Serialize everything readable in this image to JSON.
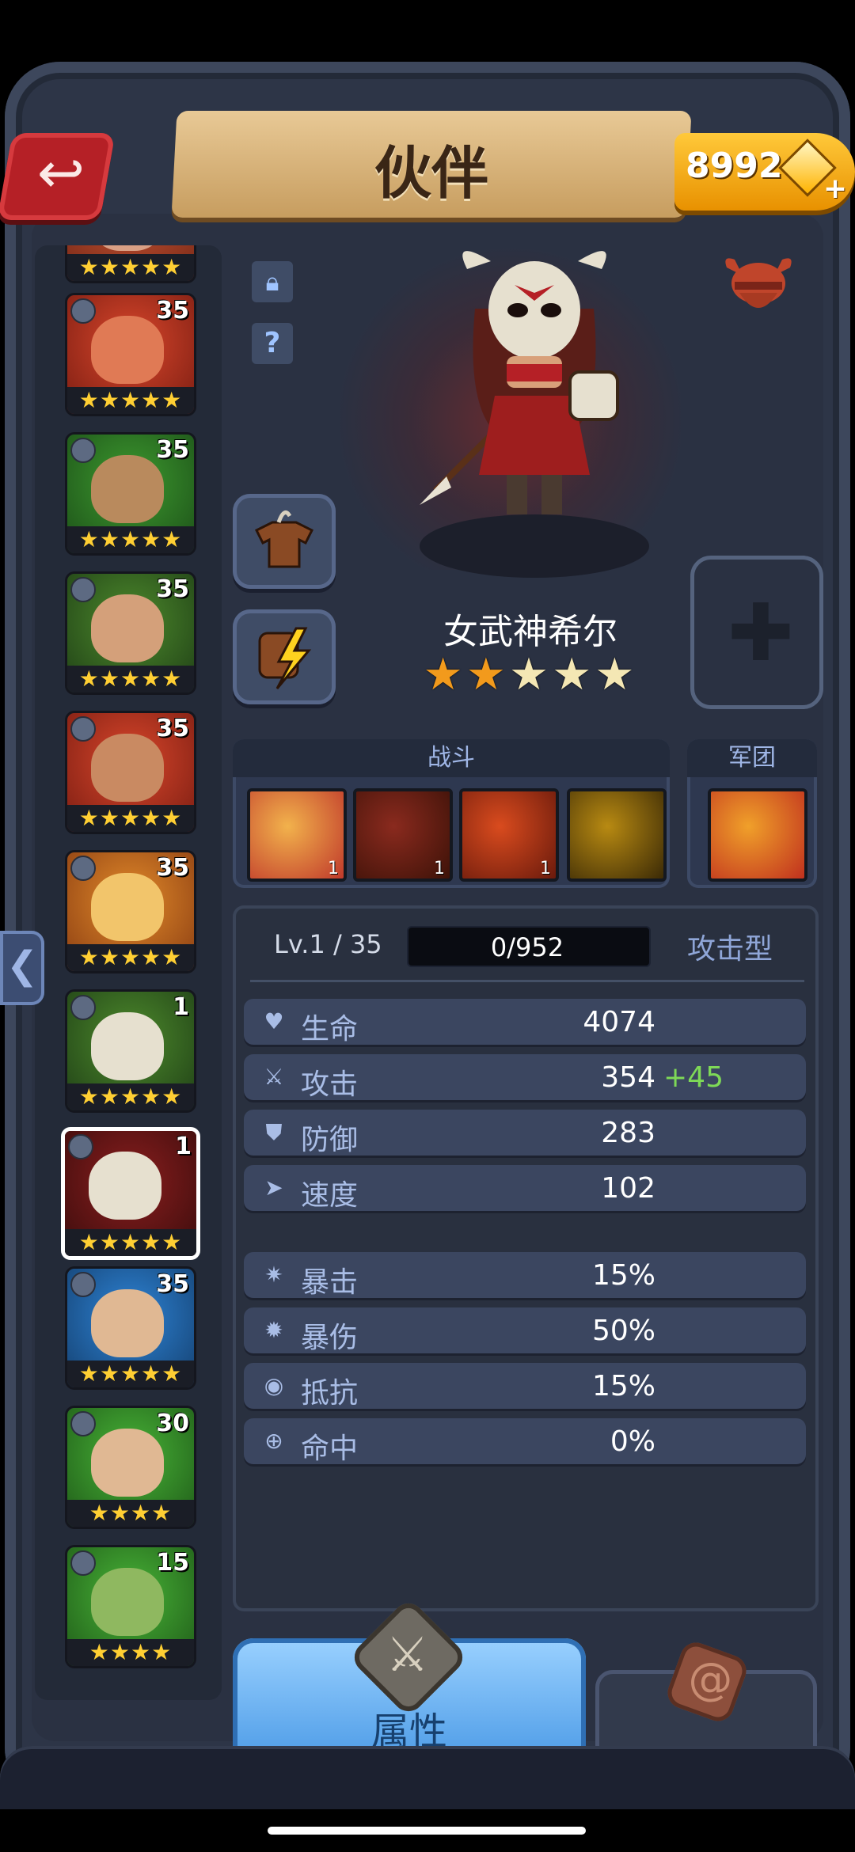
{
  "header": {
    "title": "伙伴",
    "gems": "8992",
    "back_icon": "back-arrow-icon"
  },
  "hero_list": [
    {
      "level": "",
      "stars": 5,
      "colors": [
        "#c05030",
        "#7a2a18"
      ],
      "face": "#d9a085",
      "partial": true
    },
    {
      "level": "35",
      "stars": 5,
      "colors": [
        "#d9462b",
        "#7a1d12"
      ],
      "face": "#e07a55"
    },
    {
      "level": "35",
      "stars": 5,
      "colors": [
        "#3d9a2f",
        "#1c4f18"
      ],
      "face": "#b98a5d"
    },
    {
      "level": "35",
      "stars": 5,
      "colors": [
        "#4d8a2c",
        "#1f3f16"
      ],
      "face": "#d4a07a"
    },
    {
      "level": "35",
      "stars": 5,
      "colors": [
        "#d9462b",
        "#7a1d12"
      ],
      "face": "#c98a62"
    },
    {
      "level": "35",
      "stars": 5,
      "colors": [
        "#e28a2a",
        "#8a3d12"
      ],
      "face": "#f2c56b"
    },
    {
      "level": "1",
      "stars": 5,
      "colors": [
        "#4d8a2c",
        "#1f3f16"
      ],
      "face": "#e6e0cf"
    },
    {
      "level": "1",
      "stars": 5,
      "colors": [
        "#8a1e1e",
        "#3a0c0c"
      ],
      "face": "#e6e0cf",
      "selected": true
    },
    {
      "level": "35",
      "stars": 5,
      "colors": [
        "#2e84d6",
        "#143f6e"
      ],
      "face": "#e0b893"
    },
    {
      "level": "30",
      "stars": 4,
      "colors": [
        "#48b437",
        "#1f5a18"
      ],
      "face": "#e0b893"
    },
    {
      "level": "15",
      "stars": 4,
      "colors": [
        "#48b437",
        "#1f5a18"
      ],
      "face": "#8fb860"
    }
  ],
  "hero": {
    "name": "女武神希尔",
    "stars_filled": 2,
    "stars_total": 5,
    "class_icon": "viking-helmet-icon"
  },
  "skills": {
    "battle_label": "战斗",
    "legion_label": "军团",
    "battle": [
      {
        "level": "1",
        "colors": [
          "#f2b24c",
          "#c0392b"
        ]
      },
      {
        "level": "1",
        "colors": [
          "#8a2a1e",
          "#3d1208"
        ]
      },
      {
        "level": "1",
        "colors": [
          "#d94b1e",
          "#6a1a0c"
        ]
      },
      {
        "level": "",
        "colors": [
          "#b88a12",
          "#3b2a06"
        ]
      }
    ],
    "legion": {
      "colors": [
        "#f0a02a",
        "#c0301e"
      ]
    }
  },
  "stats": {
    "level": "Lv.1 / 35",
    "xp": "0/952",
    "xp_progress": 0,
    "type": "攻击型",
    "main": [
      {
        "label": "生命",
        "value": "4074",
        "bonus": "",
        "icon": "heart-icon",
        "glyph": "♥"
      },
      {
        "label": "攻击",
        "value": "354",
        "bonus": "+45",
        "icon": "sword-icon",
        "glyph": "⚔"
      },
      {
        "label": "防御",
        "value": "283",
        "bonus": "",
        "icon": "shield-icon",
        "glyph": "⛊"
      },
      {
        "label": "速度",
        "value": "102",
        "bonus": "",
        "icon": "boot-icon",
        "glyph": "➤"
      }
    ],
    "secondary": [
      {
        "label": "暴击",
        "value": "15%",
        "icon": "crit-icon",
        "glyph": "✷"
      },
      {
        "label": "暴伤",
        "value": "50%",
        "icon": "crit-damage-icon",
        "glyph": "✹"
      },
      {
        "label": "抵抗",
        "value": "15%",
        "icon": "resist-icon",
        "glyph": "◉"
      },
      {
        "label": "命中",
        "value": "0%",
        "icon": "target-icon",
        "glyph": "⊕"
      }
    ]
  },
  "tabs": {
    "attributes": "属性"
  }
}
